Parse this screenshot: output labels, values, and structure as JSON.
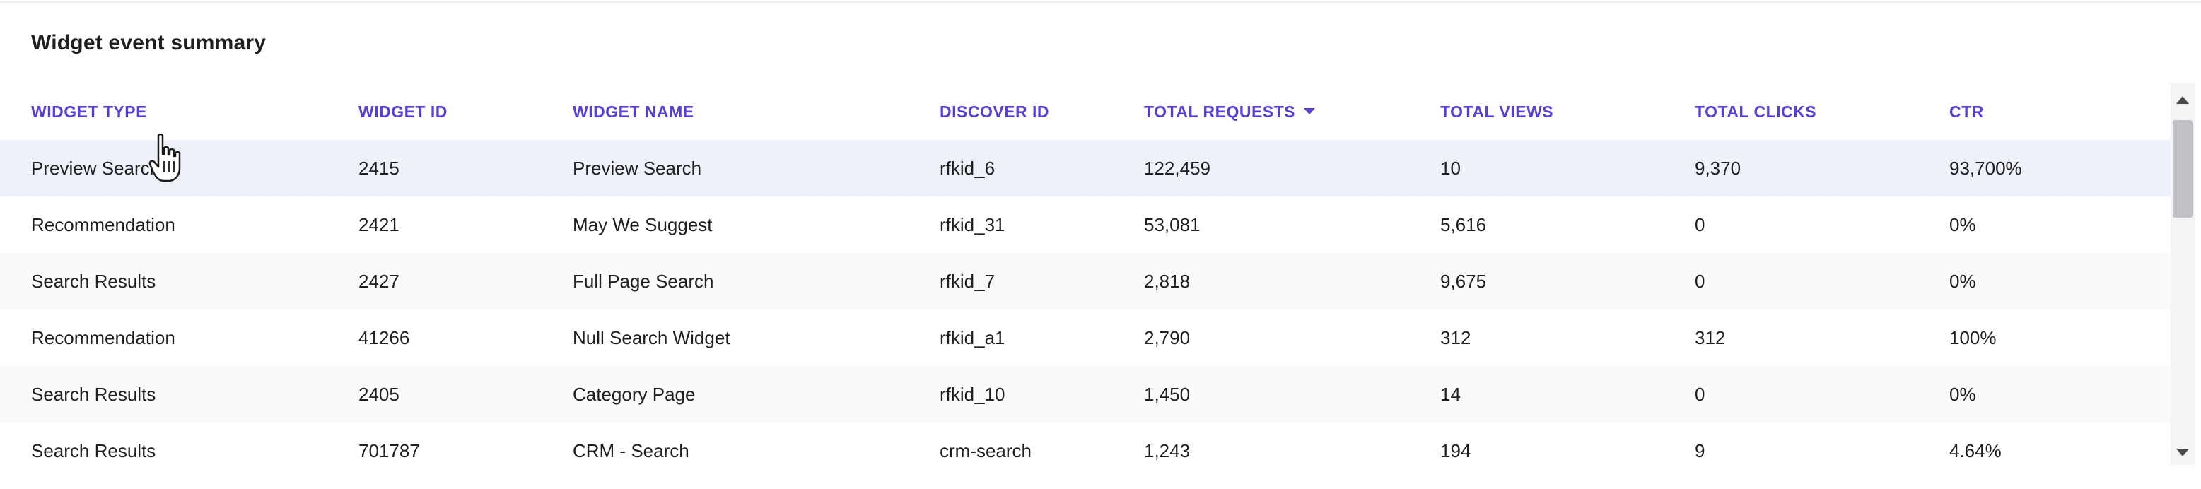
{
  "widget_summary": {
    "title": "Widget event summary",
    "columns": [
      "WIDGET TYPE",
      "WIDGET ID",
      "WIDGET NAME",
      "DISCOVER ID",
      "TOTAL REQUESTS",
      "TOTAL VIEWS",
      "TOTAL CLICKS",
      "CTR"
    ],
    "sorted_column": "TOTAL REQUESTS",
    "sort_direction": "descending",
    "sort_icon": "caret-down-icon",
    "rows": [
      [
        "Preview Search",
        "2415",
        "Preview Search",
        "rfkid_6",
        "122,459",
        "10",
        "9,370",
        "93,700%"
      ],
      [
        "Recommendation",
        "2421",
        "May We Suggest",
        "rfkid_31",
        "53,081",
        "5,616",
        "0",
        "0%"
      ],
      [
        "Search Results",
        "2427",
        "Full Page Search",
        "rfkid_7",
        "2,818",
        "9,675",
        "0",
        "0%"
      ],
      [
        "Recommendation",
        "41266",
        "Null Search Widget",
        "rfkid_a1",
        "2,790",
        "312",
        "312",
        "100%"
      ],
      [
        "Search Results",
        "2405",
        "Category Page",
        "rfkid_10",
        "1,450",
        "14",
        "0",
        "0%"
      ],
      [
        "Search Results",
        "701787",
        "CRM - Search",
        "crm-search",
        "1,243",
        "194",
        "9",
        "4.64%"
      ]
    ]
  },
  "colors": {
    "header_text": "#5a3fd6",
    "row_hover": "#eff1fa",
    "row_alt": "#fafafc",
    "scrollbar_thumb": "#c2c2c6"
  },
  "cursor": {
    "icon": "hand-pointer-icon"
  }
}
